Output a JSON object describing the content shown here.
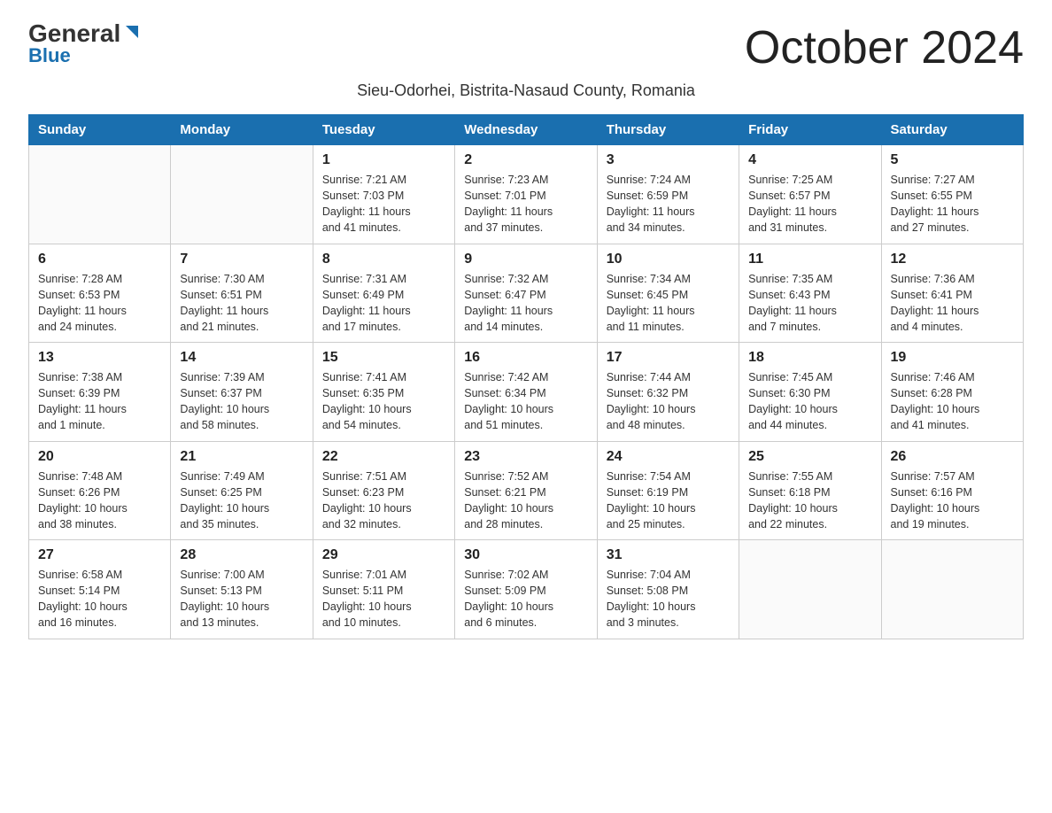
{
  "logo": {
    "general": "General",
    "blue": "Blue"
  },
  "title": "October 2024",
  "subtitle": "Sieu-Odorhei, Bistrita-Nasaud County, Romania",
  "headers": [
    "Sunday",
    "Monday",
    "Tuesday",
    "Wednesday",
    "Thursday",
    "Friday",
    "Saturday"
  ],
  "weeks": [
    [
      {
        "day": "",
        "info": ""
      },
      {
        "day": "",
        "info": ""
      },
      {
        "day": "1",
        "info": "Sunrise: 7:21 AM\nSunset: 7:03 PM\nDaylight: 11 hours\nand 41 minutes."
      },
      {
        "day": "2",
        "info": "Sunrise: 7:23 AM\nSunset: 7:01 PM\nDaylight: 11 hours\nand 37 minutes."
      },
      {
        "day": "3",
        "info": "Sunrise: 7:24 AM\nSunset: 6:59 PM\nDaylight: 11 hours\nand 34 minutes."
      },
      {
        "day": "4",
        "info": "Sunrise: 7:25 AM\nSunset: 6:57 PM\nDaylight: 11 hours\nand 31 minutes."
      },
      {
        "day": "5",
        "info": "Sunrise: 7:27 AM\nSunset: 6:55 PM\nDaylight: 11 hours\nand 27 minutes."
      }
    ],
    [
      {
        "day": "6",
        "info": "Sunrise: 7:28 AM\nSunset: 6:53 PM\nDaylight: 11 hours\nand 24 minutes."
      },
      {
        "day": "7",
        "info": "Sunrise: 7:30 AM\nSunset: 6:51 PM\nDaylight: 11 hours\nand 21 minutes."
      },
      {
        "day": "8",
        "info": "Sunrise: 7:31 AM\nSunset: 6:49 PM\nDaylight: 11 hours\nand 17 minutes."
      },
      {
        "day": "9",
        "info": "Sunrise: 7:32 AM\nSunset: 6:47 PM\nDaylight: 11 hours\nand 14 minutes."
      },
      {
        "day": "10",
        "info": "Sunrise: 7:34 AM\nSunset: 6:45 PM\nDaylight: 11 hours\nand 11 minutes."
      },
      {
        "day": "11",
        "info": "Sunrise: 7:35 AM\nSunset: 6:43 PM\nDaylight: 11 hours\nand 7 minutes."
      },
      {
        "day": "12",
        "info": "Sunrise: 7:36 AM\nSunset: 6:41 PM\nDaylight: 11 hours\nand 4 minutes."
      }
    ],
    [
      {
        "day": "13",
        "info": "Sunrise: 7:38 AM\nSunset: 6:39 PM\nDaylight: 11 hours\nand 1 minute."
      },
      {
        "day": "14",
        "info": "Sunrise: 7:39 AM\nSunset: 6:37 PM\nDaylight: 10 hours\nand 58 minutes."
      },
      {
        "day": "15",
        "info": "Sunrise: 7:41 AM\nSunset: 6:35 PM\nDaylight: 10 hours\nand 54 minutes."
      },
      {
        "day": "16",
        "info": "Sunrise: 7:42 AM\nSunset: 6:34 PM\nDaylight: 10 hours\nand 51 minutes."
      },
      {
        "day": "17",
        "info": "Sunrise: 7:44 AM\nSunset: 6:32 PM\nDaylight: 10 hours\nand 48 minutes."
      },
      {
        "day": "18",
        "info": "Sunrise: 7:45 AM\nSunset: 6:30 PM\nDaylight: 10 hours\nand 44 minutes."
      },
      {
        "day": "19",
        "info": "Sunrise: 7:46 AM\nSunset: 6:28 PM\nDaylight: 10 hours\nand 41 minutes."
      }
    ],
    [
      {
        "day": "20",
        "info": "Sunrise: 7:48 AM\nSunset: 6:26 PM\nDaylight: 10 hours\nand 38 minutes."
      },
      {
        "day": "21",
        "info": "Sunrise: 7:49 AM\nSunset: 6:25 PM\nDaylight: 10 hours\nand 35 minutes."
      },
      {
        "day": "22",
        "info": "Sunrise: 7:51 AM\nSunset: 6:23 PM\nDaylight: 10 hours\nand 32 minutes."
      },
      {
        "day": "23",
        "info": "Sunrise: 7:52 AM\nSunset: 6:21 PM\nDaylight: 10 hours\nand 28 minutes."
      },
      {
        "day": "24",
        "info": "Sunrise: 7:54 AM\nSunset: 6:19 PM\nDaylight: 10 hours\nand 25 minutes."
      },
      {
        "day": "25",
        "info": "Sunrise: 7:55 AM\nSunset: 6:18 PM\nDaylight: 10 hours\nand 22 minutes."
      },
      {
        "day": "26",
        "info": "Sunrise: 7:57 AM\nSunset: 6:16 PM\nDaylight: 10 hours\nand 19 minutes."
      }
    ],
    [
      {
        "day": "27",
        "info": "Sunrise: 6:58 AM\nSunset: 5:14 PM\nDaylight: 10 hours\nand 16 minutes."
      },
      {
        "day": "28",
        "info": "Sunrise: 7:00 AM\nSunset: 5:13 PM\nDaylight: 10 hours\nand 13 minutes."
      },
      {
        "day": "29",
        "info": "Sunrise: 7:01 AM\nSunset: 5:11 PM\nDaylight: 10 hours\nand 10 minutes."
      },
      {
        "day": "30",
        "info": "Sunrise: 7:02 AM\nSunset: 5:09 PM\nDaylight: 10 hours\nand 6 minutes."
      },
      {
        "day": "31",
        "info": "Sunrise: 7:04 AM\nSunset: 5:08 PM\nDaylight: 10 hours\nand 3 minutes."
      },
      {
        "day": "",
        "info": ""
      },
      {
        "day": "",
        "info": ""
      }
    ]
  ]
}
